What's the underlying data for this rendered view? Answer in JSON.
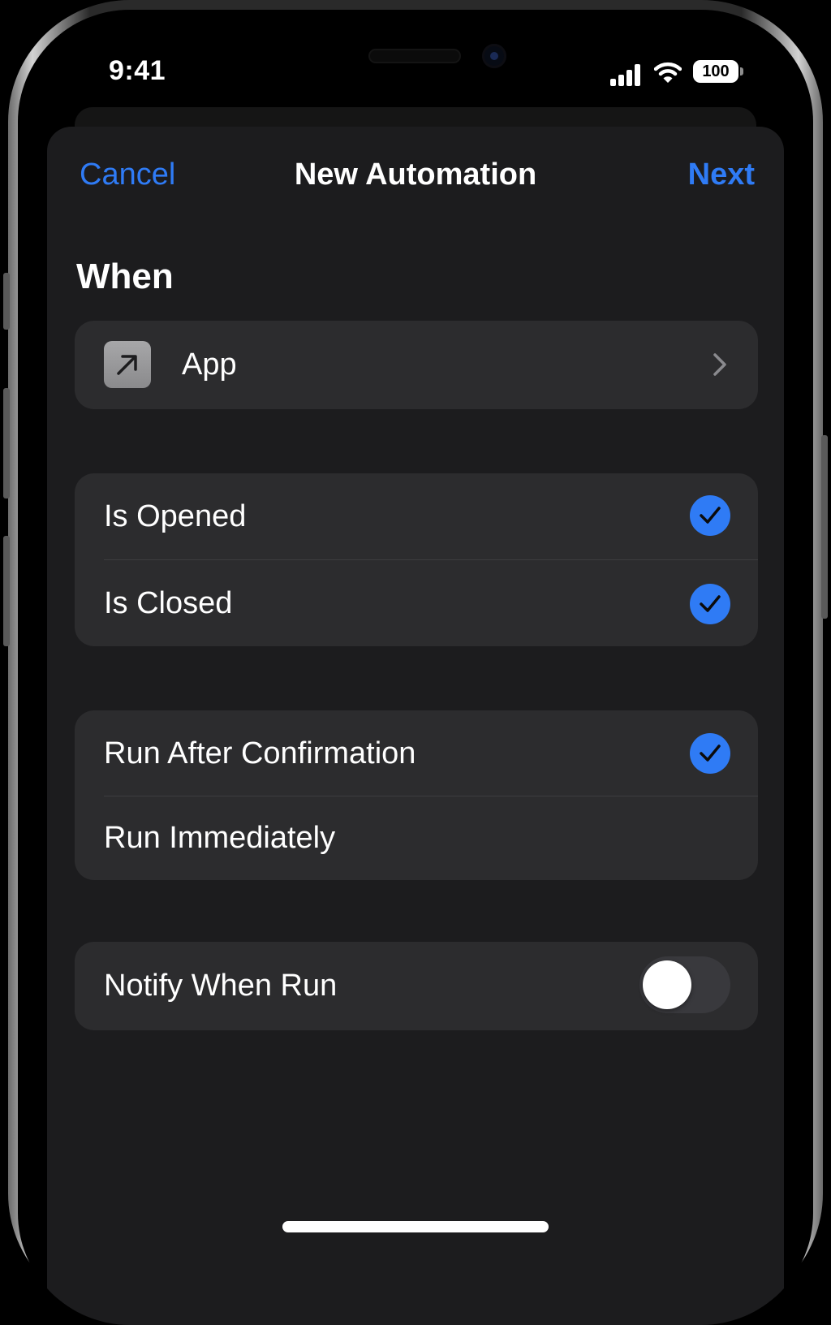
{
  "status_bar": {
    "time": "9:41",
    "battery_level": "100",
    "icons": [
      "cellular-signal-icon",
      "wifi-icon",
      "battery-icon"
    ]
  },
  "nav": {
    "cancel_label": "Cancel",
    "title": "New Automation",
    "next_label": "Next"
  },
  "section": {
    "title": "When"
  },
  "trigger": {
    "label": "App",
    "icon": "arrow-up-right-icon"
  },
  "events": [
    {
      "label": "Is Opened",
      "checked": true
    },
    {
      "label": "Is Closed",
      "checked": true
    }
  ],
  "run_options": [
    {
      "label": "Run After Confirmation",
      "checked": true
    },
    {
      "label": "Run Immediately",
      "checked": false
    }
  ],
  "notify": {
    "label": "Notify When Run",
    "enabled": false
  },
  "colors": {
    "accent": "#2f7bf5",
    "sheet_background": "#1c1c1e",
    "card_background": "#2c2c2e"
  }
}
